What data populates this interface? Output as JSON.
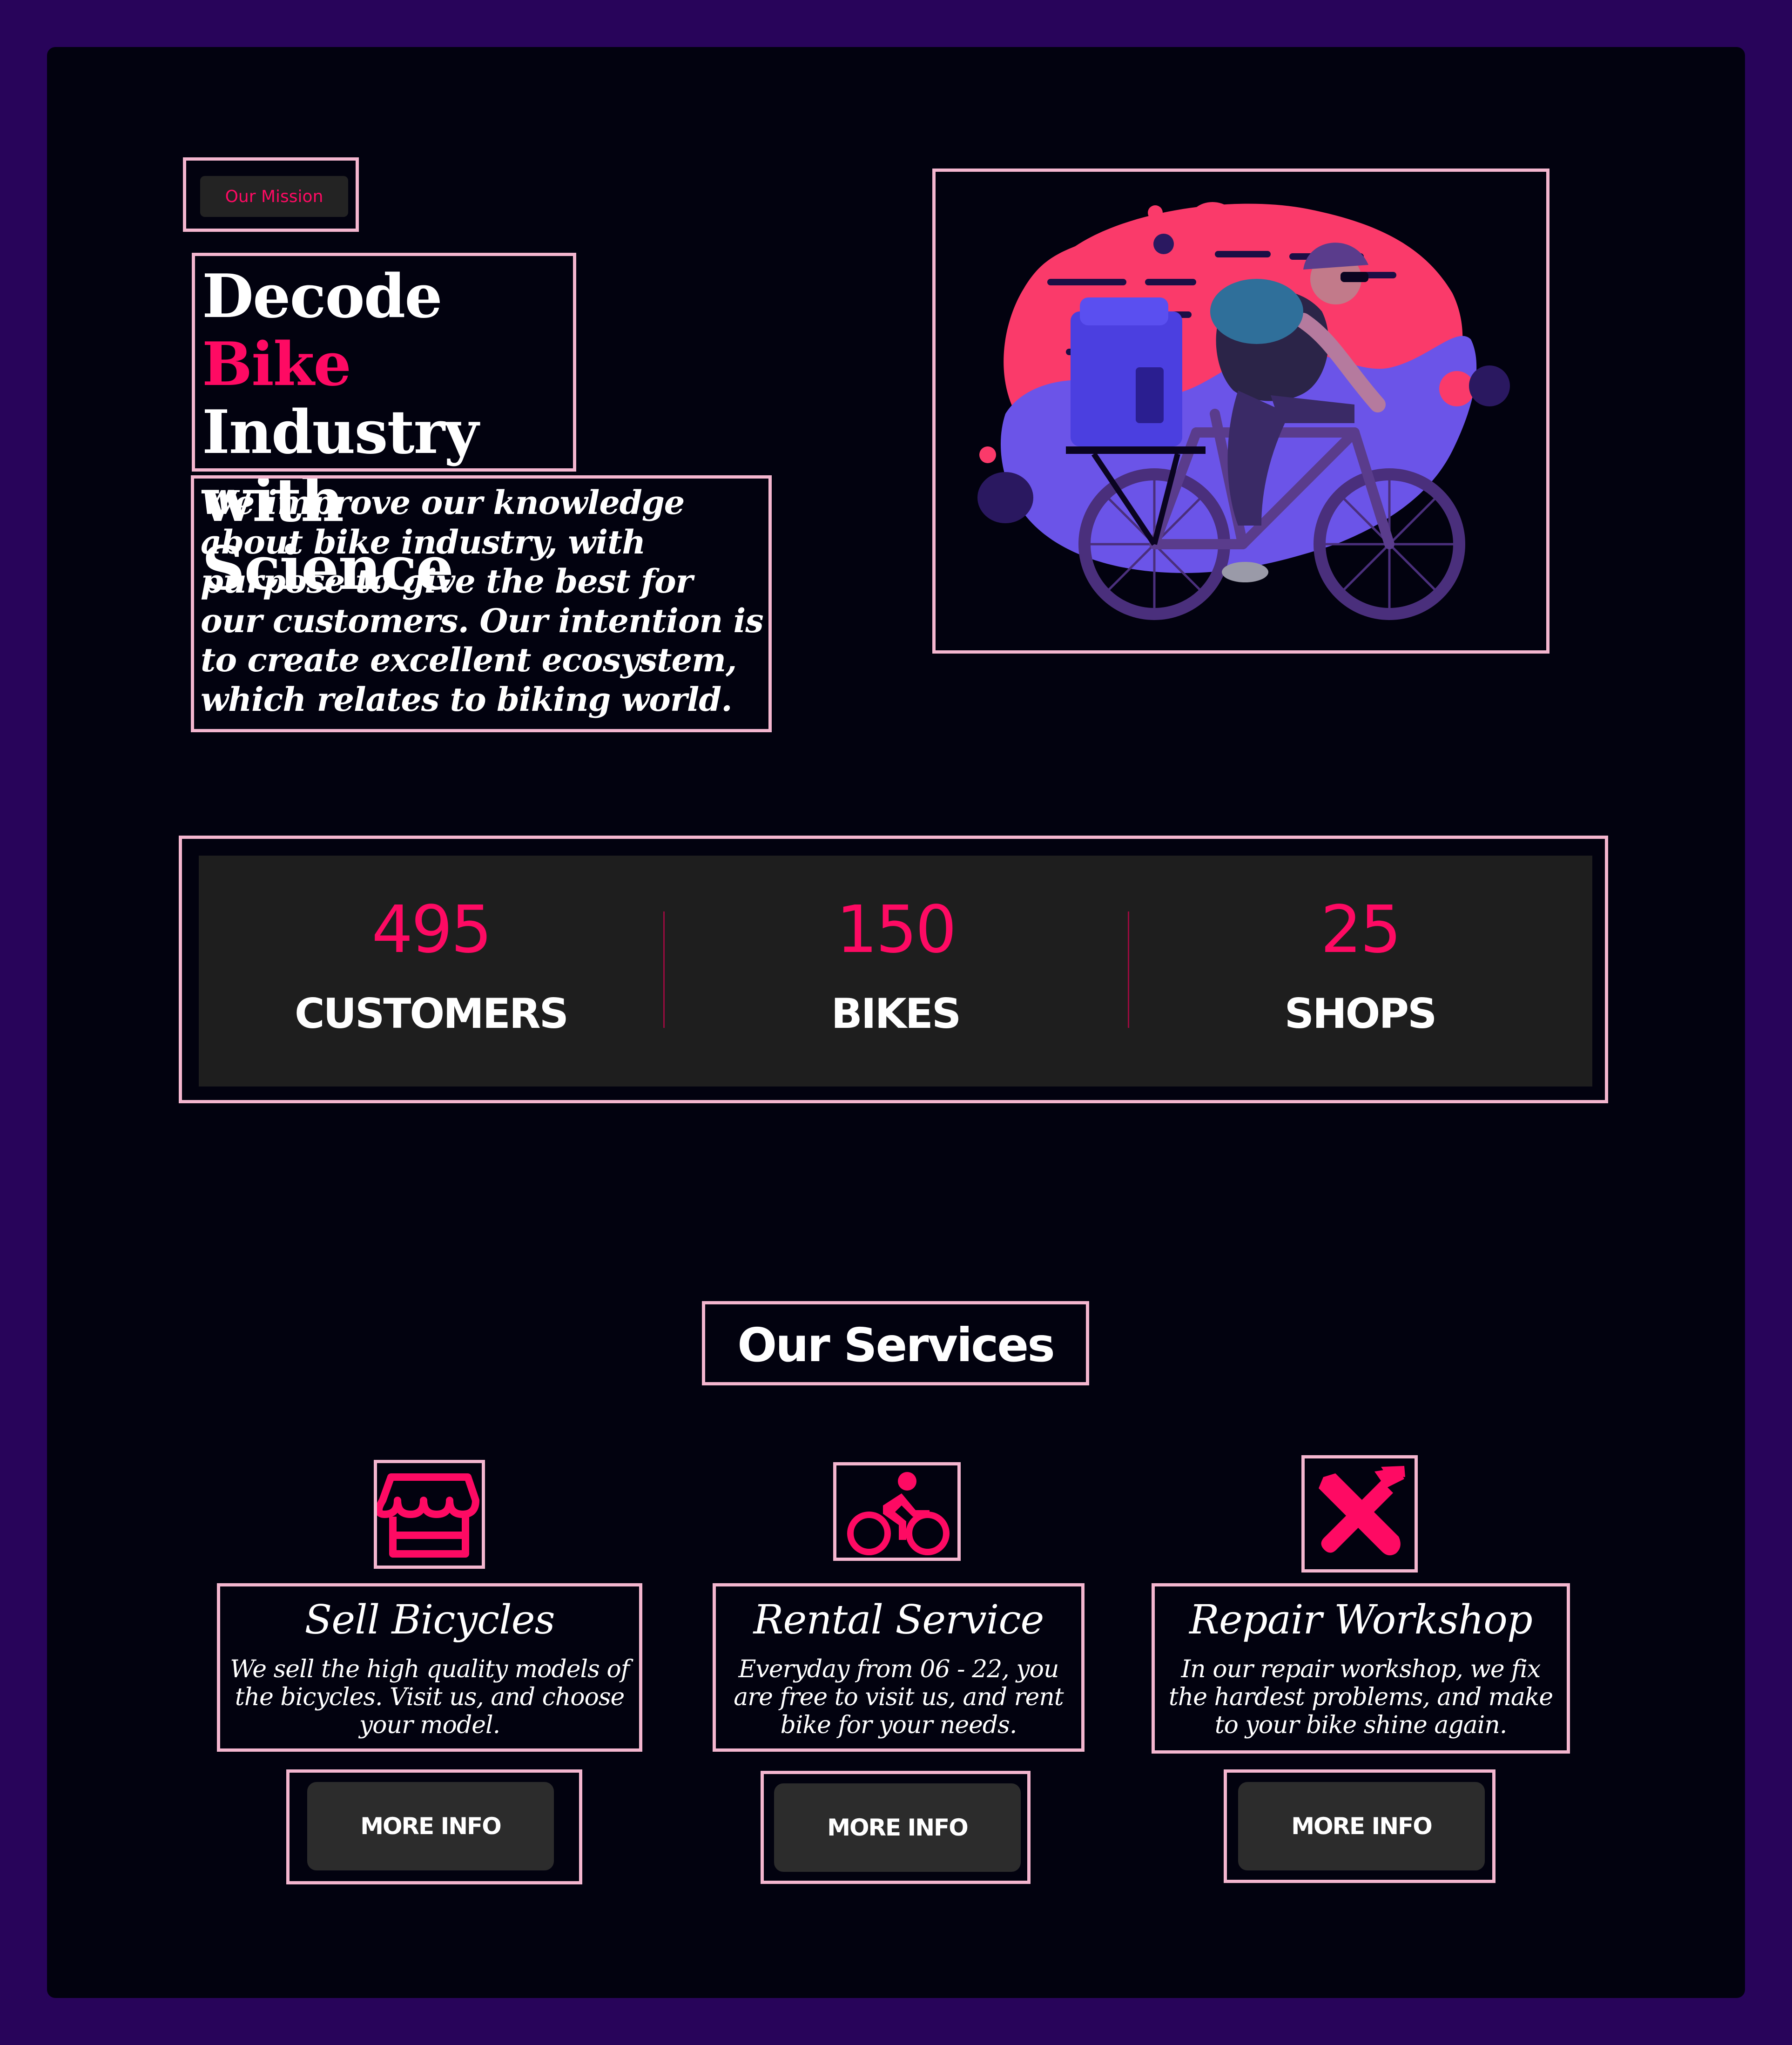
{
  "mission": {
    "badge": "Our Mission",
    "title_part1": "Decode ",
    "title_highlight": "Bike",
    "title_part2": "Industry with Science",
    "description": "We improve our knowledge about bike industry, with purpose to give the best for our customers. Our intention is to create excellent ecosystem, which relates to biking world."
  },
  "stats": [
    {
      "value": "495",
      "label": "CUSTOMERS"
    },
    {
      "value": "150",
      "label": "BIKES"
    },
    {
      "value": "25",
      "label": "SHOPS"
    }
  ],
  "services_title": "Our Services",
  "services": [
    {
      "icon": "store-icon",
      "title": "Sell Bicycles",
      "description": "We sell the high quality models of the bicycles. Visit us, and choose your model.",
      "button": "MORE INFO"
    },
    {
      "icon": "biking-icon",
      "title": "Rental Service",
      "description": "Everyday from 06 - 22, you are free to visit us, and rent bike for your needs.",
      "button": "MORE INFO"
    },
    {
      "icon": "tools-icon",
      "title": "Repair Workshop",
      "description": "In our repair workshop, we fix the hardest problems, and make to your bike shine again.",
      "button": "MORE INFO"
    }
  ],
  "colors": {
    "background": "#28045a",
    "panel": "#02020f",
    "accent": "#fe0a63",
    "outline": "#f4b6cf",
    "card": "#1e1e1e"
  }
}
